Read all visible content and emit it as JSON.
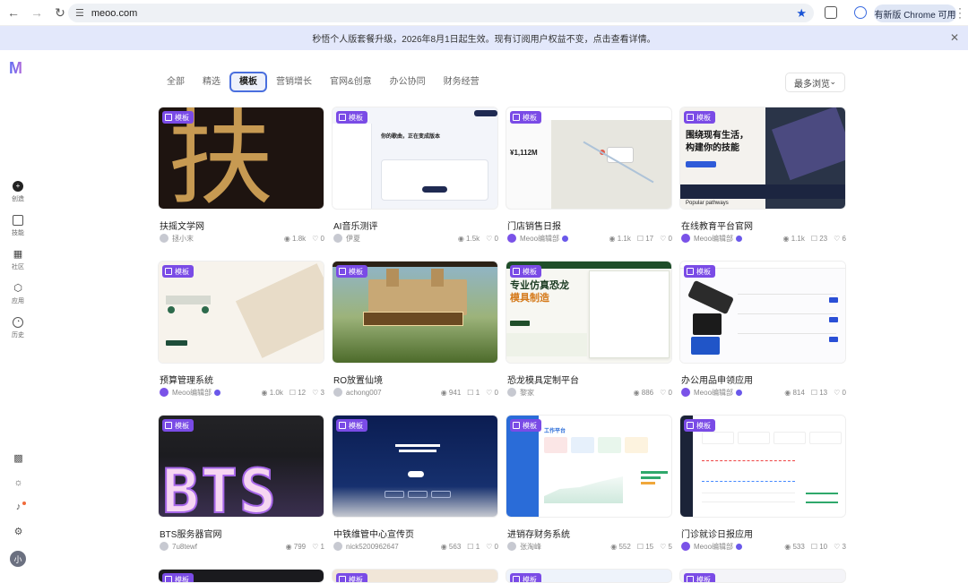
{
  "browser": {
    "url": "meoo.com",
    "update_label": "有新版 Chrome 可用"
  },
  "banner": {
    "text": "秒悟个人版套餐升级，2026年8月1日起生效。现有订阅用户权益不变，点击查看详情。"
  },
  "sidebar": {
    "items": [
      {
        "label": "创造",
        "icon": "create-icon"
      },
      {
        "label": "技能",
        "icon": "skill-icon"
      },
      {
        "label": "社区",
        "icon": "community-icon"
      },
      {
        "label": "应用",
        "icon": "apps-icon"
      },
      {
        "label": "历史",
        "icon": "history-icon"
      }
    ],
    "avatar": "小"
  },
  "tabs": [
    "全部",
    "精选",
    "模板",
    "营销增长",
    "官网&创意",
    "办公协同",
    "财务经营"
  ],
  "active_tab": "模板",
  "sort_label": "最多浏览",
  "badge_label": "模板",
  "cards": [
    {
      "title": "扶摇文学网",
      "author": "拯小末",
      "views": "1.8k",
      "comments": null,
      "likes": "0"
    },
    {
      "title": "AI音乐测评",
      "author": "伊夏",
      "views": "1.5k",
      "comments": null,
      "likes": "0"
    },
    {
      "title": "门店销售日报",
      "author": "Meoo编辑部",
      "views": "1.1k",
      "comments": "17",
      "likes": "0"
    },
    {
      "title": "在线教育平台官网",
      "author": "Meoo编辑部",
      "views": "1.1k",
      "comments": "23",
      "likes": "6"
    },
    {
      "title": "预算管理系统",
      "author": "Meoo编辑部",
      "views": "1.0k",
      "comments": "12",
      "likes": "3"
    },
    {
      "title": "RO放置仙境",
      "author": "achong007",
      "views": "941",
      "comments": "1",
      "likes": "0"
    },
    {
      "title": "恐龙模具定制平台",
      "author": "黎家",
      "views": "886",
      "comments": null,
      "likes": "0"
    },
    {
      "title": "办公用品申领应用",
      "author": "Meoo编辑部",
      "views": "814",
      "comments": "13",
      "likes": "0"
    },
    {
      "title": "BTS服务器官网",
      "author": "7u8tewf",
      "views": "799",
      "comments": null,
      "likes": "1"
    },
    {
      "title": "中铁维管中心宣传页",
      "author": "nick5200962647",
      "views": "563",
      "comments": "1",
      "likes": "0"
    },
    {
      "title": "进销存财务系统",
      "author": "张淘峰",
      "views": "552",
      "comments": "15",
      "likes": "5"
    },
    {
      "title": "门诊就诊日报应用",
      "author": "Meoo编辑部",
      "views": "533",
      "comments": "10",
      "likes": "3"
    }
  ],
  "thumbs": {
    "t1_char": "扶",
    "t2_h": "你的歌曲，正在变成版本",
    "t3_v1": "¥1,112M",
    "t4_h1": "围绕现有生活，",
    "t4_h2": "构建你的技能",
    "t4_foot": "Popular pathways",
    "t7_h1": "专业仿真恐龙",
    "t7_h2": "模具制造",
    "t9_text": "BTS",
    "t11_h": "工作平台"
  }
}
